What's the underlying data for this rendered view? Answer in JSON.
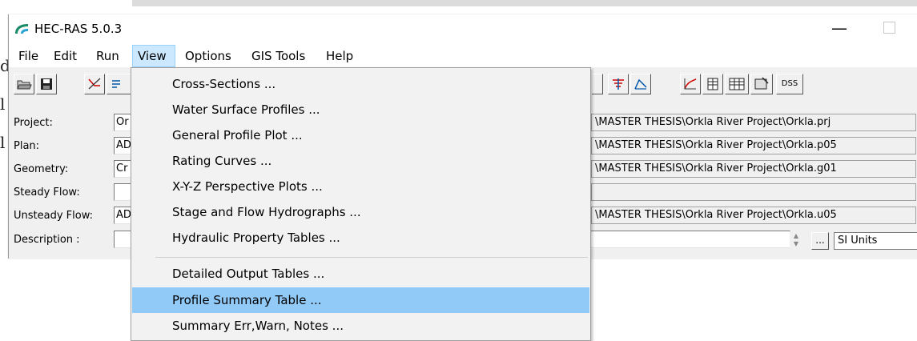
{
  "background": {
    "fragment_1": "d",
    "fragment_2": "l",
    "fragment_3": "l"
  },
  "window": {
    "title": "HEC-RAS 5.0.3",
    "minimize_glyph": "—"
  },
  "menubar": {
    "items": [
      "File",
      "Edit",
      "Run",
      "View",
      "Options",
      "GIS Tools",
      "Help"
    ],
    "active": "View"
  },
  "toolbar": {
    "left_buttons": [
      "open-icon",
      "save-icon",
      "cross-section-icon",
      "geometry-icon"
    ],
    "right_buttons": [
      "profile-icon",
      "rating-curve-icon",
      "hydraulic-table-icon",
      "summary-table-icon",
      "detailed-table-icon",
      "properties-icon"
    ],
    "dss_label": "DSS"
  },
  "fields": {
    "project_label": "Project:",
    "project_value": "Or",
    "project_path": "\\MASTER THESIS\\Orkla River Project\\Orkla.prj",
    "plan_label": "Plan:",
    "plan_value": "AD",
    "plan_path": "\\MASTER THESIS\\Orkla River Project\\Orkla.p05",
    "geometry_label": "Geometry:",
    "geometry_value": "Cr",
    "geometry_path": "\\MASTER THESIS\\Orkla River Project\\Orkla.g01",
    "steady_label": "Steady Flow:",
    "steady_value": "",
    "unsteady_label": "Unsteady Flow:",
    "unsteady_value": "AD",
    "unsteady_path": "\\MASTER THESIS\\Orkla River Project\\Orkla.u05",
    "description_label": "Description :",
    "description_value": "",
    "ellipsis_label": "...",
    "units": "SI Units"
  },
  "view_menu": {
    "items": [
      "Cross-Sections ...",
      "Water Surface Profiles ...",
      "General Profile Plot ...",
      "Rating Curves ...",
      "X-Y-Z Perspective Plots ...",
      "Stage and Flow Hydrographs ...",
      "Hydraulic Property Tables ...",
      "Detailed Output Tables ...",
      "Profile Summary Table ...",
      "Summary Err,Warn, Notes ..."
    ],
    "highlighted": "Profile Summary Table ..."
  },
  "colors": {
    "menu_highlight": "#91c9f7",
    "menubar_active": "#cce8ff",
    "window_bg": "#f0f0f0"
  }
}
